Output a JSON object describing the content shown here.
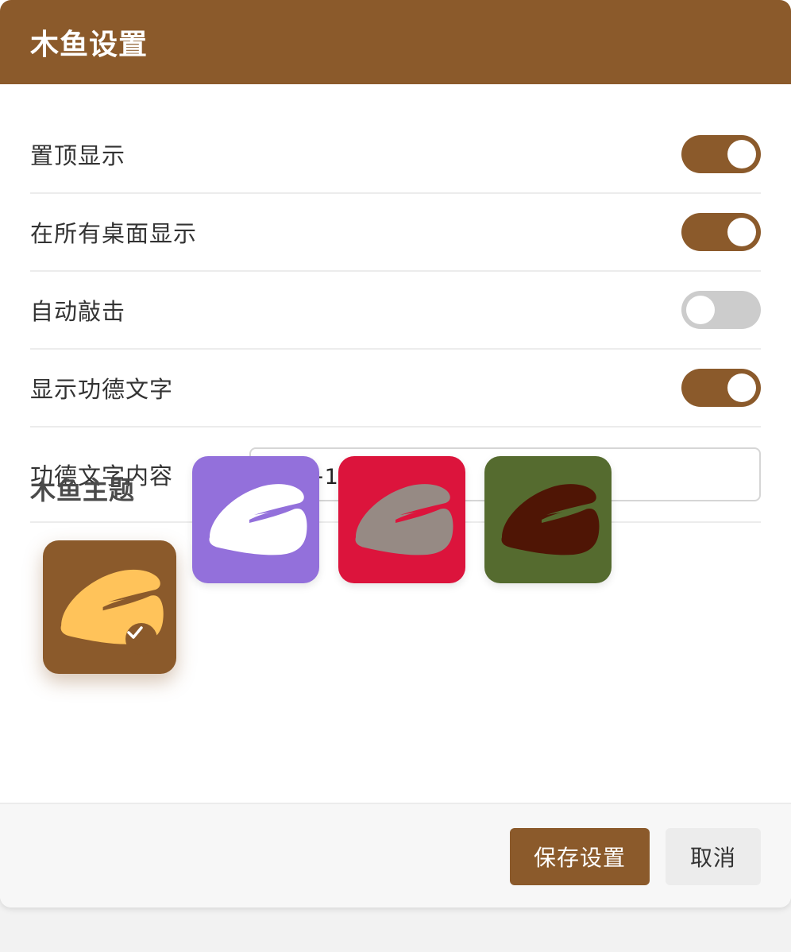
{
  "header": {
    "title": "木鱼设置"
  },
  "settings": [
    {
      "label": "置顶显示",
      "on": true
    },
    {
      "label": "在所有桌面显示",
      "on": true
    },
    {
      "label": "自动敲击",
      "on": false
    },
    {
      "label": "显示功德文字",
      "on": true
    }
  ],
  "merit_text": {
    "label": "功德文字内容",
    "value": "功德+1"
  },
  "themes": {
    "title": "木鱼主题",
    "items": [
      {
        "name": "brown",
        "background": "#8b5a2b",
        "fish": "#ffc35a",
        "selected": true
      },
      {
        "name": "purple",
        "background": "#9370db",
        "fish": "#ffffff",
        "selected": false
      },
      {
        "name": "red",
        "background": "#dc143c",
        "fish": "#968a84",
        "selected": false
      },
      {
        "name": "green",
        "background": "#556b2f",
        "fish": "#4f1505",
        "selected": false
      }
    ]
  },
  "footer": {
    "save_label": "保存设置",
    "cancel_label": "取消"
  },
  "colors": {
    "accent": "#8b5a2b",
    "toggle_off": "#cccccc"
  }
}
